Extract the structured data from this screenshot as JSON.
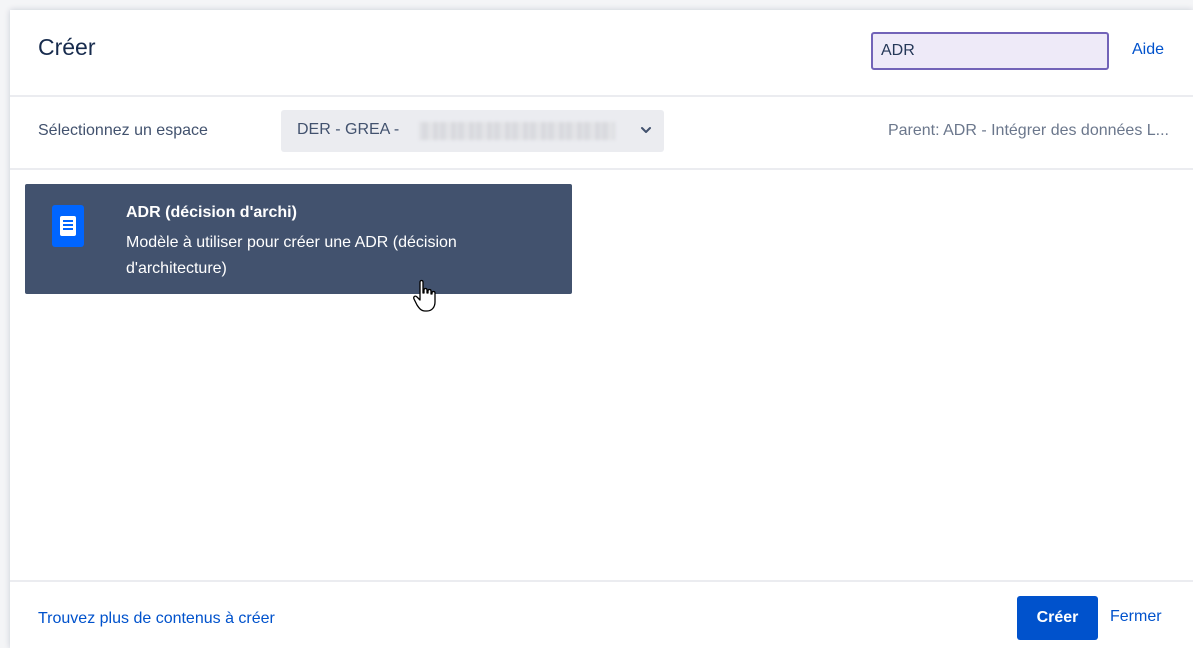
{
  "dialog": {
    "title": "Créer",
    "search": {
      "value": "ADR",
      "placeholder": ""
    },
    "help_label": "Aide"
  },
  "space_row": {
    "label": "Sélectionnez un espace",
    "selected_value": "DER - GREA -",
    "parent_text": "Parent: ADR - Intégrer des données L..."
  },
  "templates": [
    {
      "title": "ADR (décision d'archi)",
      "description": "Modèle à utiliser pour créer une ADR (décision d'architecture)",
      "icon": "page-icon"
    }
  ],
  "footer": {
    "more_link": "Trouvez plus de contenus à créer",
    "create_label": "Créer",
    "close_label": "Fermer"
  },
  "colors": {
    "primary": "#0052cc",
    "selected_card": "#42526e",
    "icon_blue": "#0065ff",
    "search_border": "#7263b8"
  }
}
